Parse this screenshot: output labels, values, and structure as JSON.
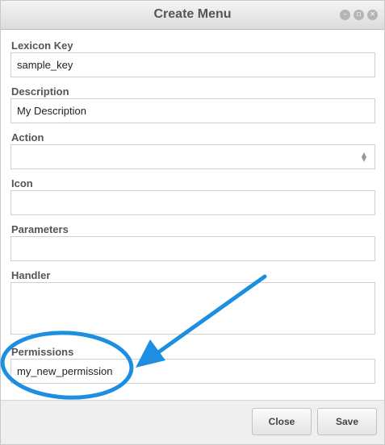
{
  "window": {
    "title": "Create Menu"
  },
  "form": {
    "lexicon_key": {
      "label": "Lexicon Key",
      "value": "sample_key"
    },
    "description": {
      "label": "Description",
      "value": "My Description"
    },
    "action": {
      "label": "Action",
      "value": ""
    },
    "icon": {
      "label": "Icon",
      "value": ""
    },
    "parameters": {
      "label": "Parameters",
      "value": ""
    },
    "handler": {
      "label": "Handler",
      "value": ""
    },
    "permissions": {
      "label": "Permissions",
      "value": "my_new_permission"
    }
  },
  "buttons": {
    "close": "Close",
    "save": "Save"
  },
  "annotation": {
    "color": "#1e8fe0"
  }
}
